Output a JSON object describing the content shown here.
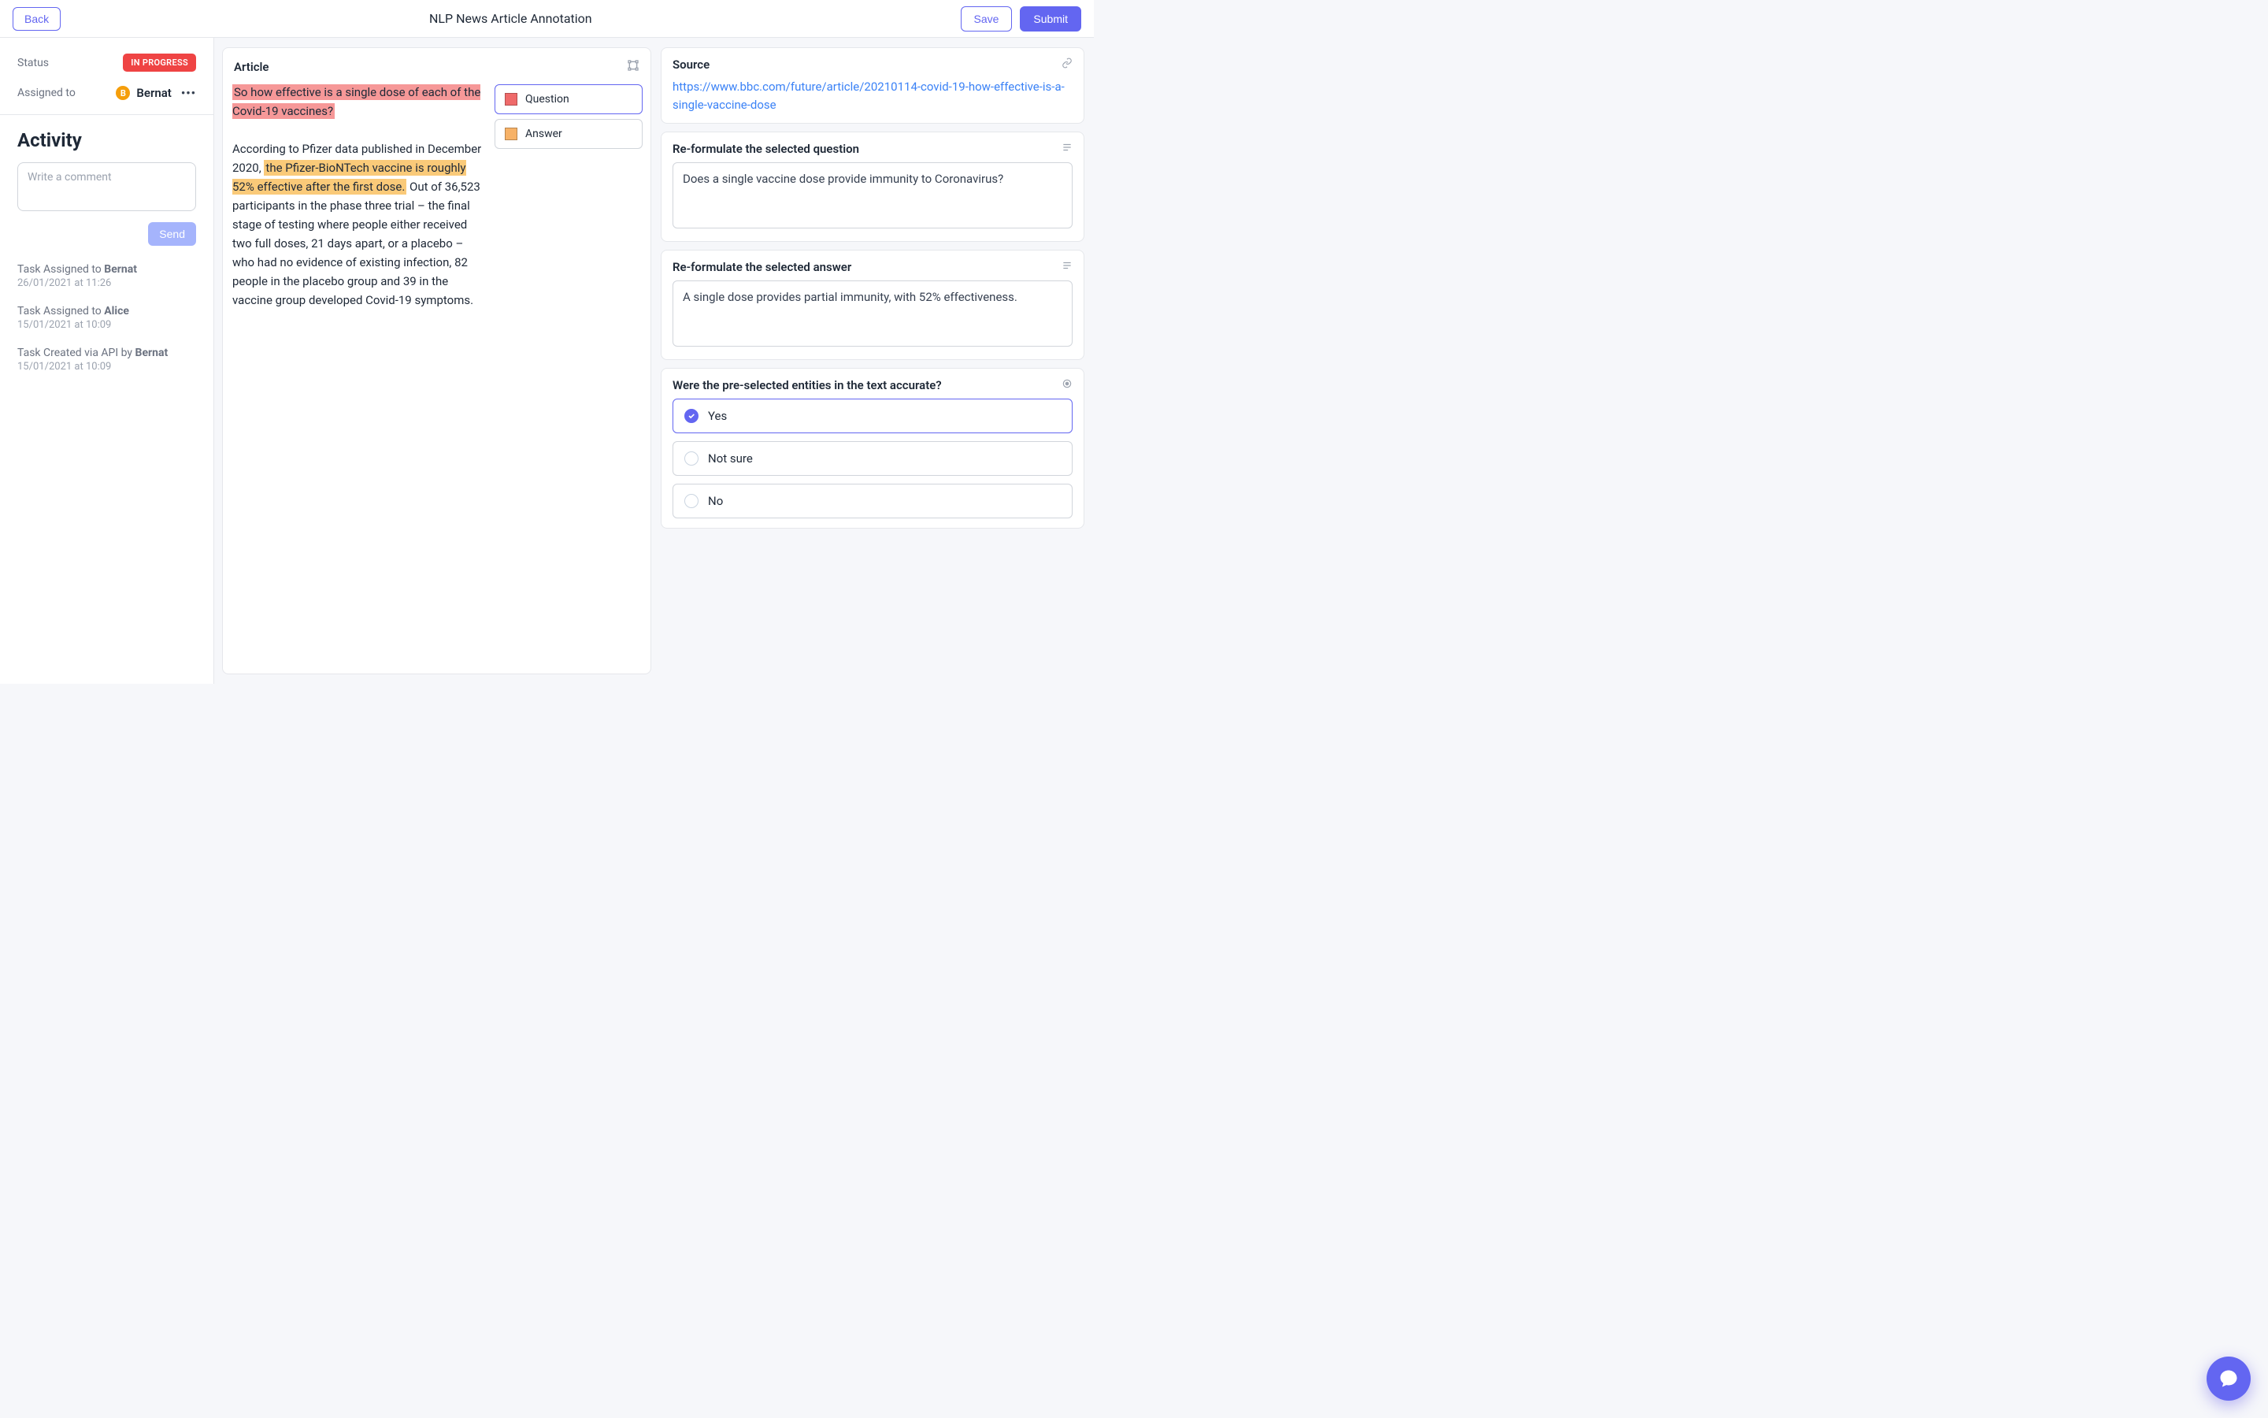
{
  "header": {
    "back": "Back",
    "title": "NLP News Article Annotation",
    "save": "Save",
    "submit": "Submit"
  },
  "sidebar": {
    "status_label": "Status",
    "status_value": "IN PROGRESS",
    "assigned_label": "Assigned to",
    "assignee_initial": "B",
    "assignee_name": "Bernat",
    "activity_title": "Activity",
    "comment_placeholder": "Write a comment",
    "send_label": "Send",
    "activity": [
      {
        "prefix": "Task Assigned to ",
        "actor": "Bernat",
        "date": "26/01/2021 at 11:26"
      },
      {
        "prefix": "Task Assigned to ",
        "actor": "Alice",
        "date": "15/01/2021 at 10:09"
      },
      {
        "prefix": "Task Created via API by ",
        "actor": "Bernat",
        "date": "15/01/2021 at 10:09"
      }
    ]
  },
  "article": {
    "title": "Article",
    "highlight_question": "So how effective is a single dose of each of the Covid-19 vaccines?",
    "body_pre": "According to Pfizer data published in December 2020, ",
    "highlight_answer": "the Pfizer-BioNTech vaccine is roughly 52% effective after the first dose.",
    "body_post": " Out of 36,523 participants in the phase three trial – the final stage of testing where people either received two full doses, 21 days apart, or a placebo – who had no evidence of existing infection, 82 people in the placebo group and 39 in the vaccine group developed Covid-19 symptoms."
  },
  "legend": {
    "question": "Question",
    "answer": "Answer"
  },
  "source": {
    "title": "Source",
    "url": "https://www.bbc.com/future/article/20210114-covid-19-how-effective-is-a-single-vaccine-dose"
  },
  "question_reform": {
    "title": "Re-formulate the selected question",
    "value": "Does a single vaccine dose provide immunity to Coronavirus?"
  },
  "answer_reform": {
    "title": "Re-formulate the selected answer",
    "value": "A single dose provides partial immunity, with 52% effectiveness."
  },
  "accuracy": {
    "title": "Were the pre-selected entities in the text accurate?",
    "options": {
      "yes": "Yes",
      "not_sure": "Not sure",
      "no": "No"
    },
    "selected": "yes"
  },
  "colors": {
    "primary": "#6366f1",
    "danger": "#ef4444",
    "question_hl": "rgba(239,68,68,.55)",
    "answer_hl": "rgba(245,158,11,.55)"
  }
}
